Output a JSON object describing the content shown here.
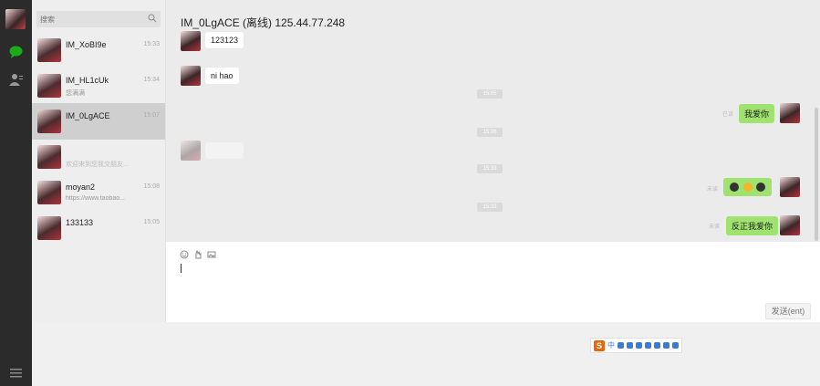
{
  "nav": {
    "icons": [
      "avatar",
      "chat-icon",
      "contacts-icon",
      "menu-icon"
    ],
    "accent": "#1aad19"
  },
  "search": {
    "placeholder": "搜索"
  },
  "chats": [
    {
      "name": "IM_XoBI9e",
      "time": "15:33",
      "preview": ""
    },
    {
      "name": "IM_HL1cUk",
      "time": "15:34",
      "preview": "您满满"
    },
    {
      "name": "IM_0LgACE",
      "time": "15:07",
      "preview": ""
    },
    {
      "name": "",
      "time": "",
      "preview": "欢迎来到您我交朋友..."
    },
    {
      "name": "moyan2",
      "time": "15:08",
      "preview": "https://www.taobao..."
    },
    {
      "name": "133133",
      "time": "15:05",
      "preview": ""
    }
  ],
  "conversation": {
    "title": "IM_0LgACE (离线) 125.44.77.248",
    "messages": [
      {
        "dir": "in",
        "text": "123123"
      },
      {
        "dir": "in",
        "text": "ni hao"
      },
      {
        "dir": "out",
        "text": "我爱你",
        "status": "已读"
      },
      {
        "dir": "out",
        "text": "",
        "status": "未读"
      },
      {
        "dir": "out",
        "text": "反正我爱你",
        "status": "未读"
      }
    ],
    "timestamps": [
      "15:05",
      "15:06",
      "15:33",
      "15:33"
    ]
  },
  "composer": {
    "send_label": "发送(ent)"
  },
  "ime": {
    "logo": "S",
    "lang": "中"
  }
}
